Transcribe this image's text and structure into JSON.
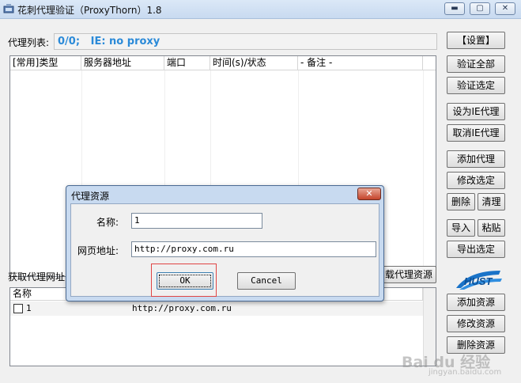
{
  "window": {
    "title": "花刺代理验证（ProxyThorn）1.8"
  },
  "proxy_list": {
    "label": "代理列表:",
    "status": "0/0;   IE: no proxy",
    "columns": [
      "[常用]类型",
      "服务器地址",
      "端口",
      "时间(s)/状态",
      "- 备注 -"
    ]
  },
  "right_buttons": {
    "settings": "【设置】",
    "verify_all": "验证全部",
    "verify_selected": "验证选定",
    "set_ie_proxy": "设为IE代理",
    "cancel_ie_proxy": "取消IE代理",
    "add_proxy": "添加代理",
    "modify_selected": "修改选定",
    "delete": "删除",
    "clear": "清理",
    "import": "导入",
    "paste": "粘贴",
    "export_selected": "导出选定",
    "add_resource": "添加资源",
    "modify_resource": "修改资源",
    "delete_resource": "删除资源"
  },
  "resources": {
    "fetch_label": "获取代理网址",
    "download_button": "载代理资源",
    "column_name": "名称",
    "rows": [
      {
        "name": "1",
        "url": "http://proxy.com.ru"
      }
    ]
  },
  "dialog": {
    "title": "代理资源",
    "close": "✕",
    "name_label": "名称:",
    "name_value": "1",
    "url_label": "网页地址:",
    "url_value": "http://proxy.com.ru",
    "ok": "OK",
    "cancel": "Cancel"
  },
  "watermark": {
    "text": "Bai du 经验",
    "sub": "jingyan.baidu.com"
  },
  "colors": {
    "status_text": "#2b8ad8",
    "highlight": "#e04545",
    "logo": "#1a73c8"
  }
}
